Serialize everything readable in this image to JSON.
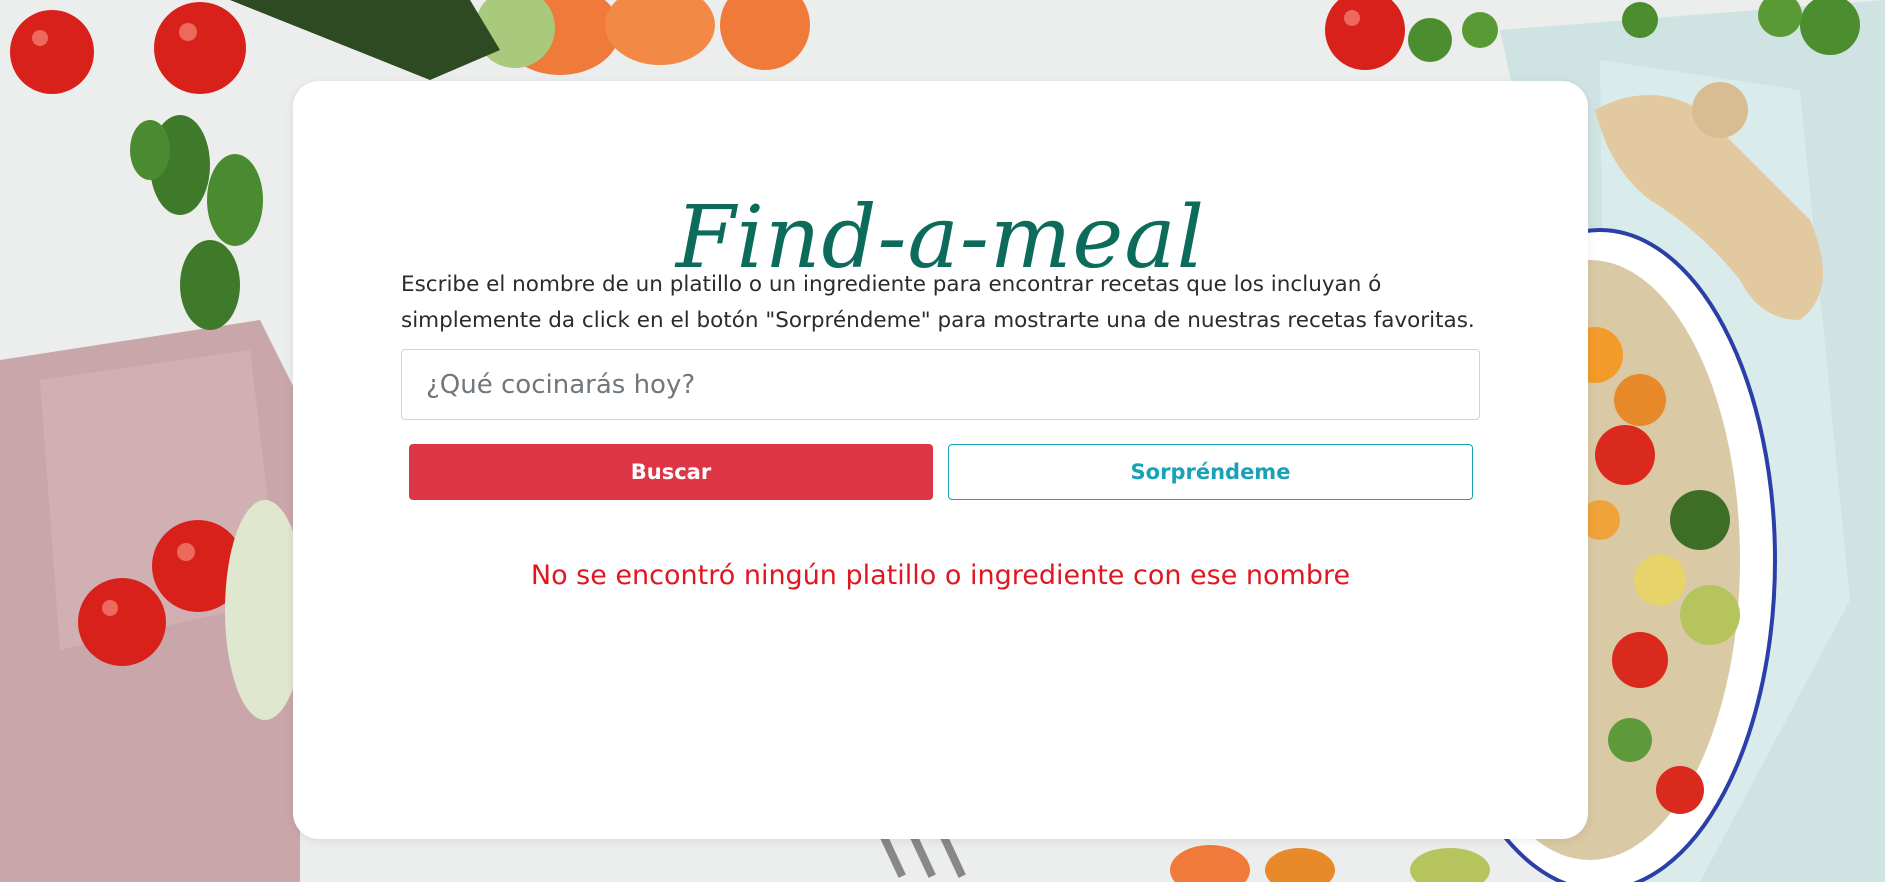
{
  "app": {
    "title": "Find-a-meal"
  },
  "main": {
    "description": "Escribe el nombre de un platillo o un ingrediente para encontrar recetas que los incluyan ó simplemente da click en el botón \"Sorpréndeme\" para mostrarte una de nuestras recetas favoritas.",
    "search": {
      "placeholder": "¿Qué cocinarás hoy?",
      "value": ""
    },
    "buttons": {
      "search_label": "Buscar",
      "surprise_label": "Sorpréndeme"
    },
    "error_message": "No se encontró ningún platillo o ingrediente con ese nombre"
  },
  "colors": {
    "title": "#0d6b5c",
    "search_button": "#dc3545",
    "surprise_button": "#17a2b8",
    "error": "#e0171f"
  }
}
